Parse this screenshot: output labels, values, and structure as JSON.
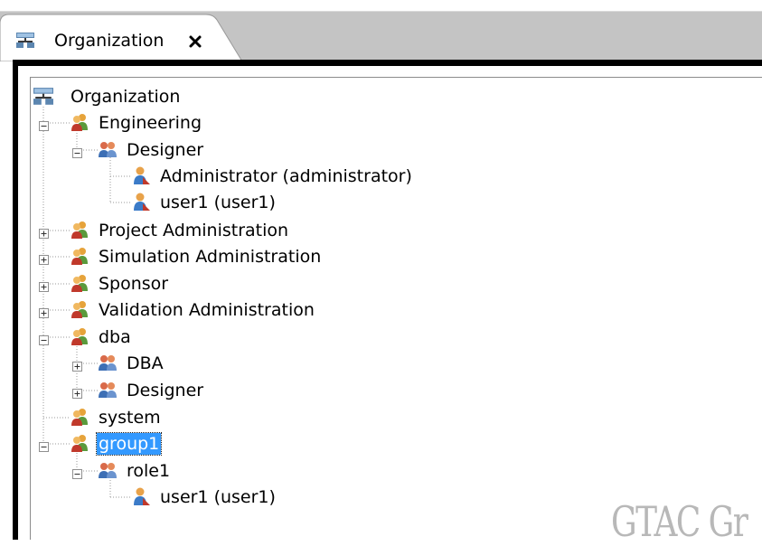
{
  "view_tab": {
    "title": "Organization",
    "icon": "organization-icon",
    "close_icon": "close-icon"
  },
  "tree": {
    "root": {
      "label": "Organization",
      "icon": "organization-icon"
    },
    "nodes": [
      {
        "label": "Engineering",
        "icon": "group-icon",
        "expander": "expanded"
      },
      {
        "label": "Designer",
        "icon": "role-icon",
        "expander": "expanded"
      },
      {
        "label": "Administrator (administrator)",
        "icon": "user-icon"
      },
      {
        "label": "user1 (user1)",
        "icon": "user-icon"
      },
      {
        "label": "Project Administration",
        "icon": "group-icon",
        "expander": "collapsed"
      },
      {
        "label": "Simulation Administration",
        "icon": "group-icon",
        "expander": "collapsed"
      },
      {
        "label": "Sponsor",
        "icon": "group-icon",
        "expander": "collapsed"
      },
      {
        "label": "Validation Administration",
        "icon": "group-icon",
        "expander": "collapsed"
      },
      {
        "label": "dba",
        "icon": "group-icon",
        "expander": "expanded"
      },
      {
        "label": "DBA",
        "icon": "role-icon",
        "expander": "collapsed"
      },
      {
        "label": "Designer",
        "icon": "role-icon",
        "expander": "collapsed"
      },
      {
        "label": "system",
        "icon": "group-icon"
      },
      {
        "label": "group1",
        "icon": "group-icon",
        "expander": "expanded",
        "selected": true
      },
      {
        "label": "role1",
        "icon": "role-icon",
        "expander": "expanded"
      },
      {
        "label": "user1 (user1)",
        "icon": "user-icon"
      }
    ]
  },
  "watermark": {
    "text": "GTAC Gr"
  },
  "colors": {
    "selection": "#3399ff",
    "tab_bar": "#c4c4c4",
    "frame": "#000000"
  }
}
